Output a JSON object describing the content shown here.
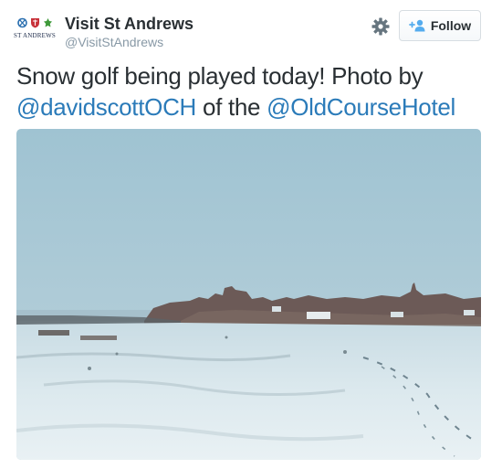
{
  "account": {
    "display_name": "Visit St Andrews",
    "handle": "@VisitStAndrews",
    "avatar_text": "ST ANDREWS"
  },
  "actions": {
    "gear_icon": "gear-icon",
    "follow_label": "Follow",
    "follow_icon": "add-user-icon"
  },
  "tweet": {
    "text_part1": "Snow golf being played today! Photo by",
    "mention1": "@davidscottOCH",
    "text_part2": " of the ",
    "mention2": "@OldCourseHotel"
  },
  "colors": {
    "mention": "#2b7bb9",
    "name": "#292f33",
    "handle": "#8899a6"
  }
}
